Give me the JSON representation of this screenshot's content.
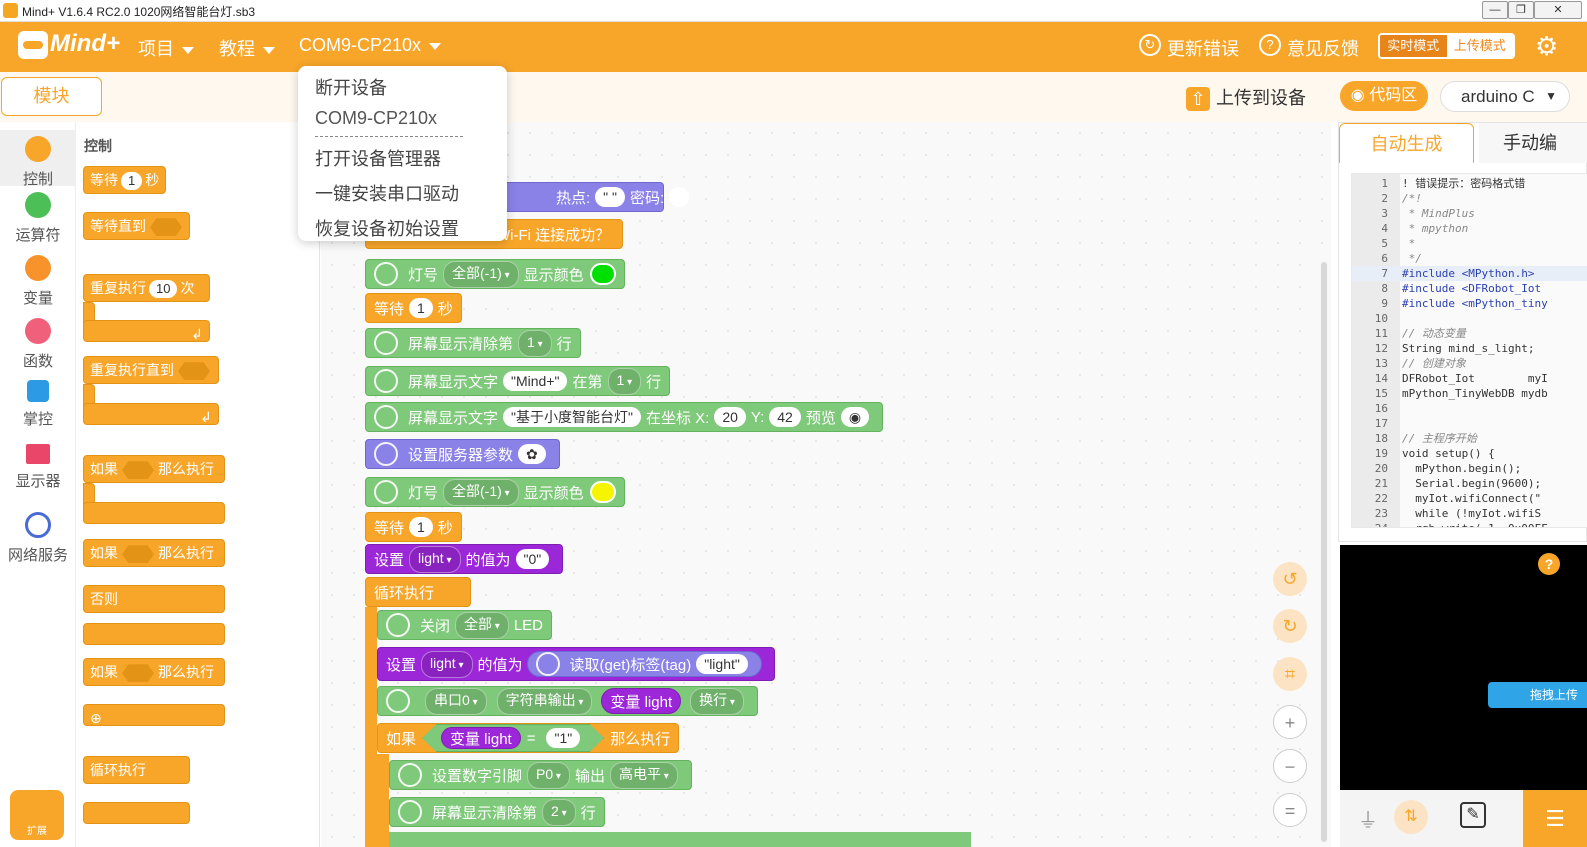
{
  "window": {
    "title": "Mind+ V1.6.4 RC2.0   1020网络智能台灯.sb3",
    "minimize": "—",
    "restore": "❐",
    "close": "✕"
  },
  "menubar": {
    "brand": "Mind+",
    "project": "项目",
    "tutorial": "教程",
    "port": "COM9-CP210x",
    "update_errors": "更新错误",
    "feedback": "意见反馈",
    "mode_realtime": "实时模式",
    "mode_upload": "上传模式",
    "colors": {
      "accent": "#f7a62a"
    }
  },
  "toolbar2": {
    "modules": "模块",
    "upload": "上传到设备",
    "code_region": "代码区",
    "language": "arduino C"
  },
  "categories": [
    {
      "label": "控制",
      "color": "#f7a62a"
    },
    {
      "label": "运算符",
      "color": "#4cbf56"
    },
    {
      "label": "变量",
      "color": "#f7932a"
    },
    {
      "label": "函数",
      "color": "#f0607a"
    },
    {
      "label": "掌控",
      "icon": "chip-icon"
    },
    {
      "label": "显示器",
      "icon": "display-icon"
    },
    {
      "label": "网络服务",
      "icon": "globe-icon"
    }
  ],
  "extensions": "扩展",
  "flyout": {
    "header": "控制",
    "wait": "等待",
    "wait_val": "1",
    "wait_unit": "秒",
    "wait_until": "等待直到",
    "repeat": "重复执行",
    "repeat_val": "10",
    "repeat_unit": "次",
    "repeat_until": "重复执行直到",
    "if": "如果",
    "then": "那么执行",
    "else": "否则",
    "forever": "循环执行"
  },
  "dropdown": {
    "disconnect": "断开设备",
    "port": "COM9-CP210x",
    "device_manager": "打开设备管理器",
    "install_driver": "一键安装串口驱动",
    "restore": "恢复设备初始设置"
  },
  "workspace": {
    "b1_hotspot": "热点:",
    "b1_ssid": "\" \"",
    "b1_pwd": "密码:",
    "b2_wifi": "Wi-Fi 连接成功？",
    "b2_tag": "WiFi",
    "b3_light": "灯号",
    "b3_all": "全部(-1)",
    "b3_show": "显示颜色",
    "b4_wait": "等待",
    "b4_val": "1",
    "b4_unit": "秒",
    "b5_clear": "屏幕显示清除第",
    "b5_val": "1",
    "b5_row": "行",
    "b6_text": "屏幕显示文字",
    "b6_str": "\"Mind+\"",
    "b6_at": "在第",
    "b6_val": "1",
    "b6_row": "行",
    "b7_text": "屏幕显示文字",
    "b7_str": "\"基于小度智能台灯\"",
    "b7_at": "在坐标 X:",
    "b7_x": "20",
    "b7_y_lbl": "Y:",
    "b7_y": "42",
    "b7_preview": "预览",
    "b8_server": "设置服务器参数",
    "b9_light": "灯号",
    "b9_all": "全部(-1)",
    "b9_show": "显示颜色",
    "b10_wait": "等待",
    "b10_val": "1",
    "b10_unit": "秒",
    "b11_set": "设置",
    "b11_var": "light",
    "b11_val_lbl": "的值为",
    "b11_val": "\"0\"",
    "b12_forever": "循环执行",
    "b13_off": "关闭",
    "b13_all": "全部",
    "b13_led": "LED",
    "b14_set": "设置",
    "b14_var": "light",
    "b14_val_lbl": "的值为",
    "b14_read": "读取(get)标签(tag)",
    "b14_tag": "\"light\"",
    "b15_serial": "串口0",
    "b15_mode": "字符串输出",
    "b15_var": "变量 light",
    "b15_nl": "换行",
    "b16_if": "如果",
    "b16_var": "变量 light",
    "b16_eq": "=",
    "b16_val": "\"1\"",
    "b16_then": "那么执行",
    "b17_pin": "设置数字引脚",
    "b17_p": "P0",
    "b17_out": "输出",
    "b17_level": "高电平",
    "b18_clear": "屏幕显示清除第",
    "b18_val": "2",
    "b18_row": "行"
  },
  "code": {
    "tab_auto": "自动生成",
    "tab_manual": "手动编",
    "lines": [
      "! 错误提示：密码格式错",
      "/*!",
      " * MindPlus",
      " * mpython",
      " *",
      " */",
      "#include <MPython.h>",
      "#include <DFRobot_Iot",
      "#include <mPython_tiny",
      "",
      "// 动态变量",
      "String mind_s_light;",
      "// 创建对象",
      "DFRobot_Iot        myI",
      "mPython_TinyWebDB mydb",
      "",
      "",
      "// 主程序开始",
      "void setup() {",
      "  mPython.begin();",
      "  Serial.begin(9600);",
      "  myIot.wifiConnect(\"",
      "  while (!myIot.wifiS",
      "  rgb.write(-1, 0x00FF"
    ]
  },
  "terminal": {
    "help": "?",
    "drag_upload": "拖拽上传"
  }
}
